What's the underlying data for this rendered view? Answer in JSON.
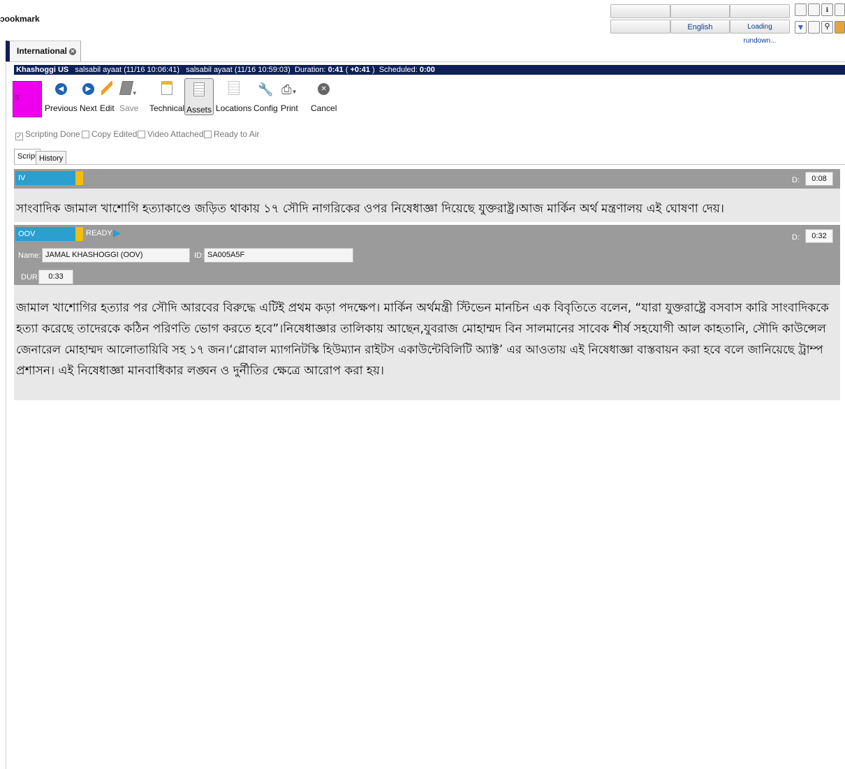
{
  "app": {
    "title": "ɔookmark"
  },
  "top_bar": {
    "language": "English",
    "rundown_status": "Loading rundown..."
  },
  "tabs": [
    {
      "label": "International"
    }
  ],
  "story_header": {
    "slug": "Khashoggi US",
    "created": "salsabil ayaat (11/16 10:06:41)",
    "modified": "salsabil ayaat (11/16 10:59:03)",
    "duration_label": "Duration:",
    "duration": "0:41",
    "over_under": "+0:41",
    "scheduled_label": "Scheduled:",
    "scheduled": "0:00"
  },
  "toolbar": {
    "slug_swatch_text": "S",
    "swatch_color": "#ee00ee",
    "previous": "Previous",
    "next": "Next",
    "edit": "Edit",
    "save": "Save",
    "technical": "Technical",
    "assets": "Assets",
    "locations": "Locations",
    "config": "Config",
    "print": "Print",
    "cancel": "Cancel"
  },
  "status_checks": [
    {
      "label": "Scripting Done",
      "checked": true
    },
    {
      "label": "Copy Edited",
      "checked": false
    },
    {
      "label": "Video Attached",
      "checked": false
    },
    {
      "label": "Ready to Air",
      "checked": false
    }
  ],
  "script_tabs": {
    "script": "Script",
    "history": "History"
  },
  "blocks": [
    {
      "type": "IV",
      "duration_label": "D:",
      "duration": "0:08",
      "text": "সাংবাদিক জামাল খাশোগি হত্যাকাণ্ডে জড়িত থাকায় ১৭ সৌদি নাগরিকের ওপর নিষেধাজ্ঞা দিয়েছে যুক্তরাষ্ট্র।আজ মার্কিন অর্থ মন্ত্রণালয় এই ঘোষণা দেয়।"
    },
    {
      "type": "OOV",
      "status": "READY",
      "duration_label": "D:",
      "duration": "0:32",
      "name_label": "Name:",
      "name": "JAMAL KHASHOGGI (OOV)",
      "id_label": "ID:",
      "id": "SA005A5F",
      "dur_label": "DUR:",
      "dur": "0:33",
      "text_lines": [
        "জামাল খাশোগির হত্যার পর সৌদি আরবের বিরুদ্ধে এটিই প্রথম কড়া পদক্ষেপ। মার্কিন অর্থমন্ত্রী স্টিভেন মানচিন এক বিবৃতিতে বলেন, “যারা যুক্তরাষ্ট্রে বসবাস কারি সাংবাদিককে",
        "হত্যা করেছে তাদেরকে কঠিন পরিণতি ভোগ করতে হবে”।নিষেধাজ্ঞার তালিকায় আছেন,যুবরাজ মোহাম্মদ বিন সালমানের সাবেক শীর্ষ সহযোগী আল কাহতানি, সৌদি কাউন্সেল",
        "জেনারেল মোহাম্মদ আলোতায়িবি সহ ১৭ জন।‘গ্লোবাল ম্যাগনিটস্কি হিউম্যান রাইটস একাউন্টেবিলিটি অ্যাক্ট’ এর আওতায় এই নিষেধাজ্ঞা বাস্তবায়ন করা হবে বলে জানিয়েছে ট্রাম্প",
        "প্রশাসন। এই নিষেধাজ্ঞা মানবাধিকার লঙ্ঘন ও দুর্নীতির  ক্ষেত্রে আরোপ করা হয়।"
      ]
    }
  ]
}
